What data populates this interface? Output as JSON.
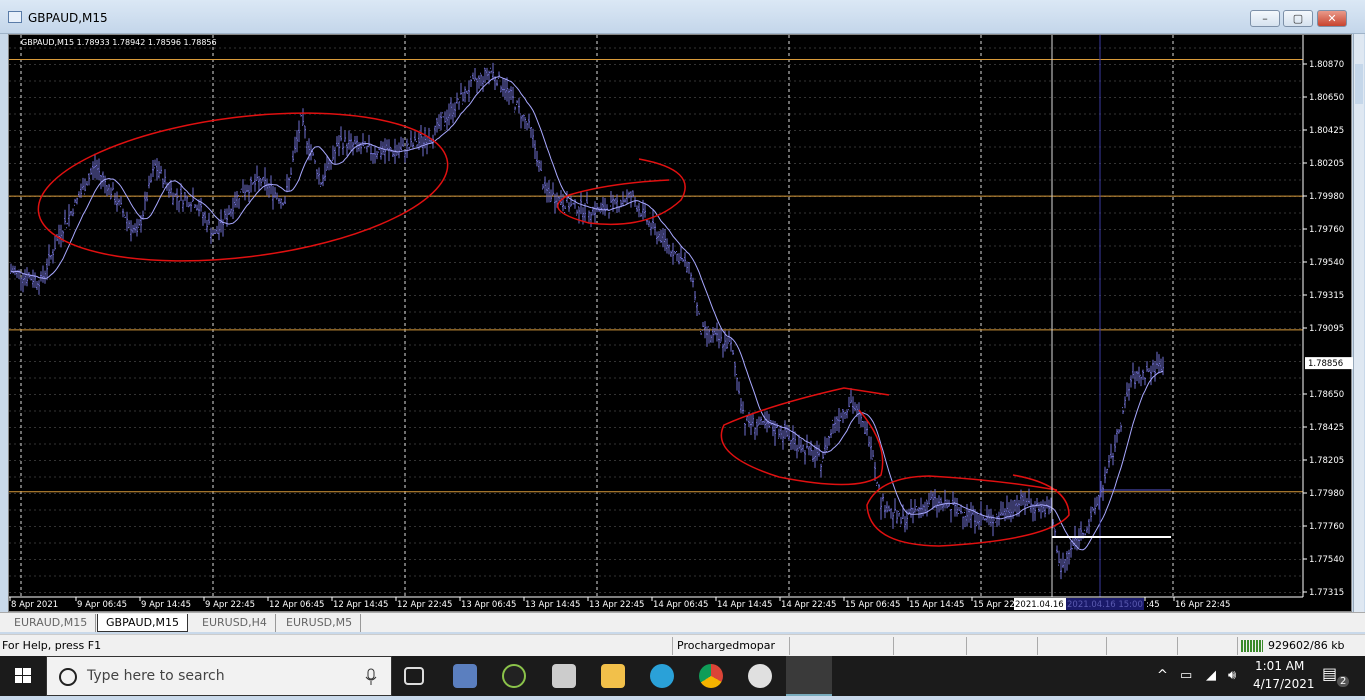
{
  "window": {
    "title": "GBPAUD,M15",
    "minimize": "–",
    "maximize": "▢",
    "close": "✕"
  },
  "chart": {
    "info_line": "GBPAUD,M15  1.78933 1.78942 1.78596 1.78856",
    "current_price_label": "1.78856",
    "crosshair_time_labels": [
      "2021.04.16",
      "2021.04.16 15:00"
    ],
    "colors": {
      "bars": "#6f6fcf",
      "moving_average": "#a8a8ff",
      "level_lines": "#d89a3a",
      "annotations": "#e01010",
      "background": "#000000"
    }
  },
  "chart_data": {
    "type": "bar",
    "symbol": "GBPAUD",
    "timeframe": "M15",
    "y_ticks": [
      "1.80870",
      "1.80650",
      "1.80425",
      "1.80205",
      "1.79980",
      "1.79760",
      "1.79540",
      "1.79315",
      "1.79095",
      "1.78856",
      "1.78650",
      "1.78425",
      "1.78205",
      "1.77980",
      "1.77760",
      "1.77540",
      "1.77315"
    ],
    "ylim": [
      1.77315,
      1.8087
    ],
    "x_ticks": [
      "8 Apr 2021",
      "9 Apr 06:45",
      "9 Apr 14:45",
      "9 Apr 22:45",
      "12 Apr 06:45",
      "12 Apr 14:45",
      "12 Apr 22:45",
      "13 Apr 06:45",
      "13 Apr 14:45",
      "13 Apr 22:45",
      "14 Apr 06:45",
      "14 Apr 14:45",
      "14 Apr 22:45",
      "15 Apr 06:45",
      "15 Apr 14:45",
      "15 Apr 22:",
      "",
      ":45",
      "16 Apr 22:45"
    ],
    "horizontal_levels": [
      1.809,
      1.7998,
      1.7908,
      1.7799
    ],
    "approx_close_path": [
      [
        "8 Apr 22:45",
        1.79476
      ],
      [
        "9 Apr 02:30",
        1.79409
      ],
      [
        "9 Apr 05:00",
        1.79746
      ],
      [
        "9 Apr 09:15",
        1.80183
      ],
      [
        "9 Apr 11:15",
        1.80015
      ],
      [
        "9 Apr 14:30",
        1.79712
      ],
      [
        "9 Apr 16:45",
        1.80183
      ],
      [
        "9 Apr 19:15",
        1.79981
      ],
      [
        "9 Apr 21:45",
        1.79948
      ],
      [
        "12 Apr 00:15",
        1.79712
      ],
      [
        "12 Apr 03:30",
        1.80015
      ],
      [
        "12 Apr 06:00",
        1.80082
      ],
      [
        "12 Apr 09:00",
        1.79948
      ],
      [
        "12 Apr 11:00",
        1.80486
      ],
      [
        "12 Apr 13:30",
        1.80082
      ],
      [
        "12 Apr 16:00",
        1.80352
      ],
      [
        "12 Apr 19:45",
        1.80284
      ],
      [
        "12 Apr 23:30",
        1.80284
      ],
      [
        "13 Apr 03:15",
        1.80385
      ],
      [
        "13 Apr 05:45",
        1.80554
      ],
      [
        "13 Apr 08:15",
        1.80722
      ],
      [
        "13 Apr 10:45",
        1.80823
      ],
      [
        "13 Apr 13:15",
        1.80655
      ],
      [
        "13 Apr 15:45",
        1.80419
      ],
      [
        "13 Apr 17:30",
        1.80015
      ],
      [
        "13 Apr 20:45",
        1.79914
      ],
      [
        "14 Apr 00:30",
        1.7988
      ],
      [
        "14 Apr 04:15",
        1.79981
      ],
      [
        "14 Apr 06:45",
        1.79779
      ],
      [
        "14 Apr 11:45",
        1.79476
      ],
      [
        "14 Apr 13:00",
        1.79072
      ],
      [
        "14 Apr 16:45",
        1.78971
      ],
      [
        "14 Apr 18:30",
        1.78466
      ],
      [
        "14 Apr 23:00",
        1.78399
      ],
      [
        "15 Apr 04:00",
        1.78197
      ],
      [
        "15 Apr 05:45",
        1.78466
      ],
      [
        "15 Apr 07:45",
        1.78601
      ],
      [
        "15 Apr 10:15",
        1.78332
      ],
      [
        "15 Apr 11:30",
        1.77928
      ],
      [
        "15 Apr 14:00",
        1.77793
      ],
      [
        "15 Apr 17:45",
        1.77928
      ],
      [
        "15 Apr 21:30",
        1.7786
      ],
      [
        "16 Apr 01:15",
        1.77793
      ],
      [
        "16 Apr 05:00",
        1.77928
      ],
      [
        "16 Apr 08:45",
        1.7786
      ],
      [
        "16 Apr 10:00",
        1.77456
      ],
      [
        "16 Apr 11:45",
        1.77658
      ],
      [
        "16 Apr 13:45",
        1.77793
      ],
      [
        "16 Apr 16:15",
        1.78197
      ],
      [
        "16 Apr 18:45",
        1.78736
      ],
      [
        "16 Apr 22:45",
        1.78856
      ]
    ]
  },
  "tabs": [
    {
      "label": "EURAUD,M15"
    },
    {
      "label": "GBPAUD,M15"
    },
    {
      "label": "EURUSD,H4"
    },
    {
      "label": "EURUSD,M5"
    }
  ],
  "status": {
    "help": "For Help, press F1",
    "profile": "Prochargedmopar",
    "traffic": "929602/86 kb"
  },
  "taskbar": {
    "search_placeholder": "Type here to search",
    "time": "1:01 AM",
    "date": "4/17/2021",
    "notifications": "2"
  }
}
